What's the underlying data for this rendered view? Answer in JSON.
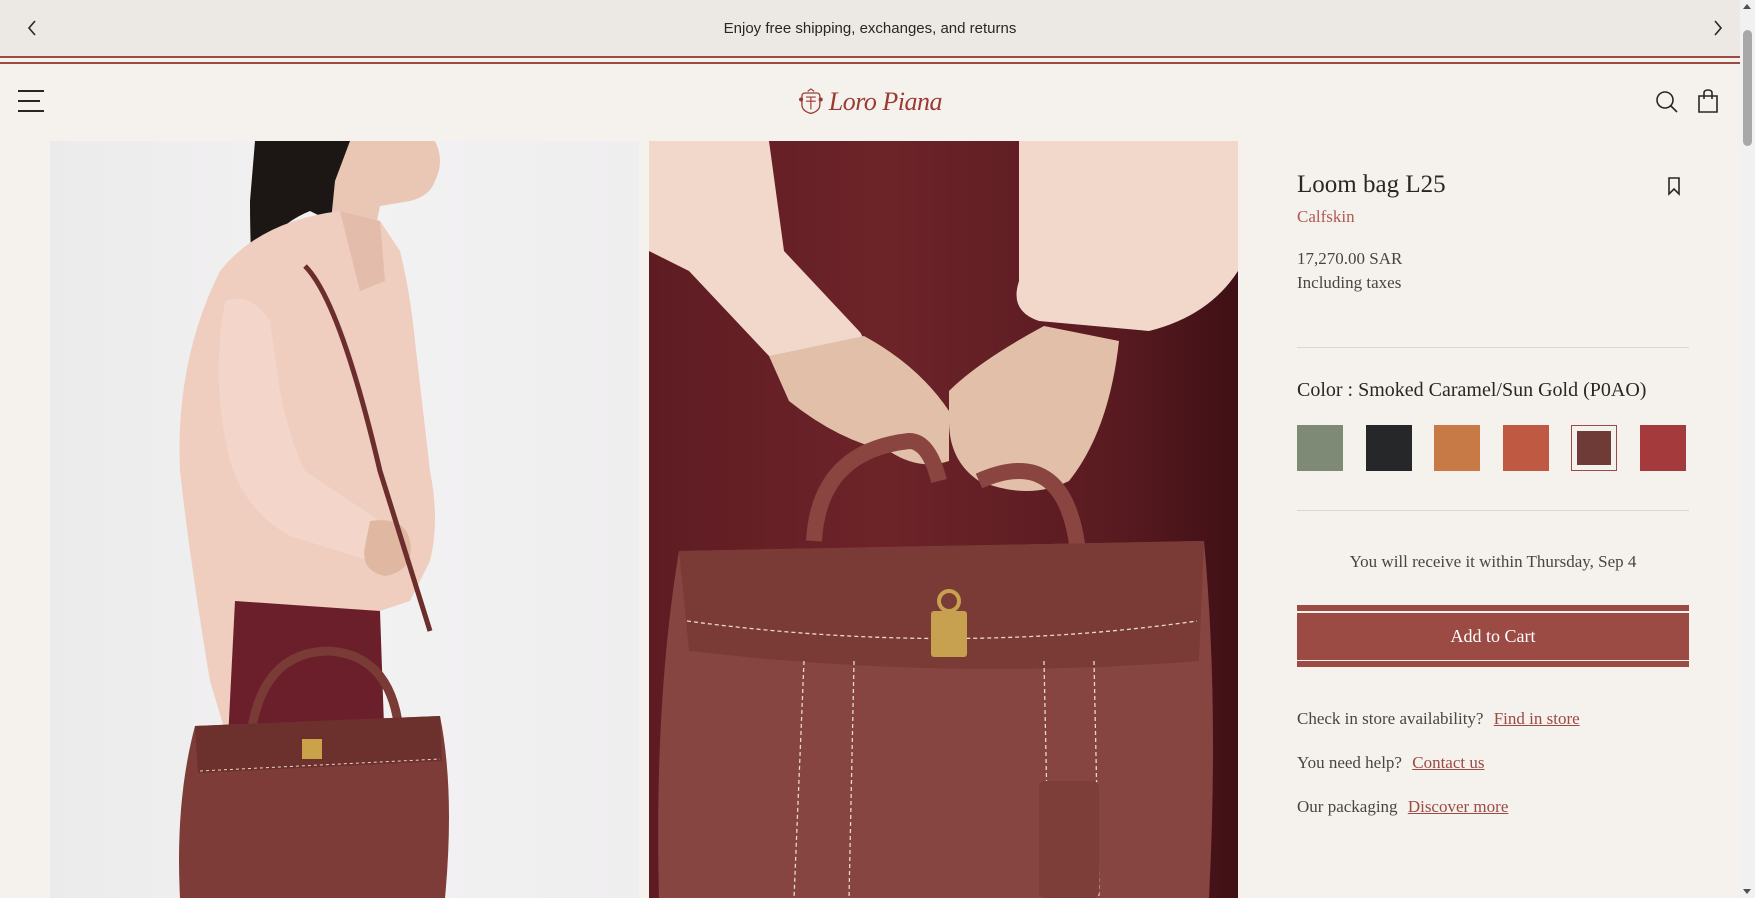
{
  "announcement": {
    "text": "Enjoy free shipping, exchanges, and returns",
    "prev_icon": "chevron-left-icon",
    "next_icon": "chevron-right-icon"
  },
  "header": {
    "menu_icon": "hamburger-menu-icon",
    "logo_text": "Loro Piana",
    "search_icon": "search-icon",
    "bag_icon": "shopping-bag-icon"
  },
  "gallery": {
    "images": [
      {
        "subject": "model-side-view-with-bag"
      },
      {
        "subject": "hands-holding-bag-closeup"
      }
    ]
  },
  "product": {
    "title": "Loom bag L25",
    "material": "Calfskin",
    "price": "17,270.00 SAR",
    "tax_note": "Including taxes",
    "bookmark_icon": "bookmark-icon",
    "color_label": "Color : Smoked Caramel/Sun Gold (P0AO)",
    "swatches": [
      {
        "color": "#7e8a76"
      },
      {
        "color": "#262729"
      },
      {
        "color": "#c77a45"
      },
      {
        "color": "#c05942"
      },
      {
        "color": "#6e3b36",
        "selected": true
      },
      {
        "color": "#a43a3c"
      }
    ],
    "delivery_text": "You will receive it within Thursday, Sep 4",
    "add_to_cart": "Add to Cart",
    "store_prompt": "Check in store availability?",
    "store_link": "Find in store",
    "help_prompt": "You need help?",
    "help_link": "Contact us",
    "packaging_prompt": "Our packaging",
    "packaging_link": "Discover more"
  },
  "theme": {
    "accent": "#9b4a44",
    "background": "#f5f2ee"
  }
}
